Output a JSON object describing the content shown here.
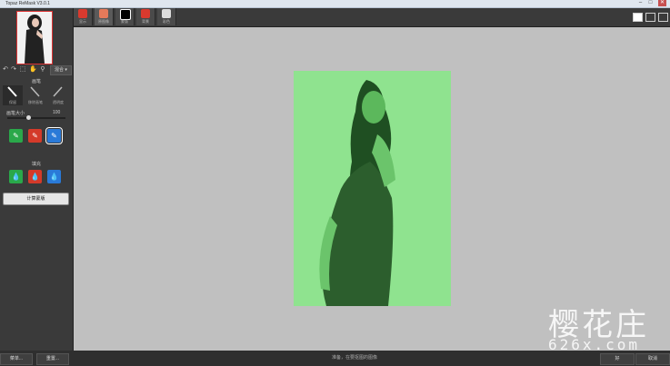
{
  "window": {
    "title": "Topaz ReMask V3.0.1",
    "controls": [
      "–",
      "□",
      "✕"
    ]
  },
  "left_panel": {
    "mode_select": "混合",
    "brush_section_title": "画笔",
    "brushes": [
      {
        "label": "保留"
      },
      {
        "label": "移除画笔"
      },
      {
        "label": "透明度"
      }
    ],
    "size_label": "画笔大小",
    "size_value": "100",
    "fill_section_title": "填充",
    "compute_label": "计算蒙版"
  },
  "top_tabs": [
    {
      "label": "显示",
      "color": "#d93a2e"
    },
    {
      "label": "原图像",
      "color": "#e67a5a"
    },
    {
      "label": "蒙版",
      "color": "#ffffff"
    },
    {
      "label": "背景",
      "color": "#d93a2e"
    },
    {
      "label": "彩色",
      "color": "#dddddd"
    }
  ],
  "bottom_bar": {
    "menu_label": "菜单...",
    "reset_label": "重置...",
    "status_text": "准备，在要抠图的图像",
    "ok_label": "好",
    "cancel_label": "取消"
  },
  "watermark": {
    "chars": "樱花庄",
    "url": "626x.com"
  }
}
